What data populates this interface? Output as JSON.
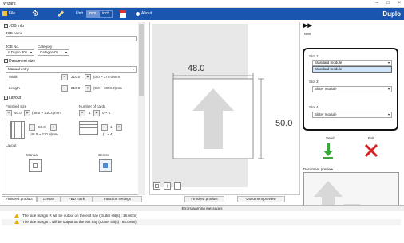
{
  "window": {
    "title": "Wizard",
    "minimize": "–",
    "maximize": "□",
    "close": "×"
  },
  "toolbar": {
    "file_label": "File",
    "unit_label": "Unit",
    "unit_mm": "mm",
    "unit_inch": "inch",
    "about_label": "About",
    "brand": "Duplo"
  },
  "left": {
    "job_info_title": "JOB info",
    "job_name_label": "JOB name",
    "job_name_value": "",
    "job_no_label": "JOB No.",
    "job_no_value": "n Duplo 801",
    "category_label": "Category",
    "category_value": "Category01",
    "doc_size_title": "Document size",
    "doc_size_mode": "Manual entry",
    "width_label": "Width",
    "width_value": "210.0",
    "width_range": "(0.0 ~ 370.0)mm",
    "length_label": "Length",
    "length_value": "210.0",
    "length_range": "(0.0 ~ 1000.0)mm",
    "layout_title": "Layout",
    "finished_size_label": "Finished size",
    "finished_size_value": "40.0",
    "finished_size_range": "(48.0 ~ 210.0)mm",
    "num_cards_label": "Number of cards",
    "num_cards_value": "1",
    "num_cards_range": "0 ~ 6",
    "inner_value": "50.0",
    "inner_range": "(48.0 ~ 210.0)mm",
    "inner_cards_value": "1",
    "inner_cards_range": "(1 ~ 4)",
    "layout_mode_label": "Layout",
    "manual_label": "Manual",
    "center_label": "Center"
  },
  "tabs": [
    "Finished product",
    "Crease",
    "FBD mark",
    "Function settings"
  ],
  "canvas": {
    "width_dim": "48.0",
    "height_dim": "50.0",
    "bottom_tabs": [
      "Finished product",
      "Document preview"
    ]
  },
  "right": {
    "next_label": "Next",
    "slot1_label": "Slot 1",
    "slot1_value": "Standard module",
    "slot1_option": "Standard module",
    "slot3_label": "Slot 3",
    "slot3_value": "Slitter module",
    "slot4_label": "Slot 4",
    "slot4_value": "Slitter module",
    "send_label": "Send",
    "exit_label": "Exit",
    "doc_preview_label": "Document preview"
  },
  "errors": {
    "header": "Errors/warning messages",
    "rows": [
      "The side margin R will be output on the exit tray (Gutter slit(s) :  39.0mm)",
      "The side margin L will be output on the exit tray (Cutter slit(s) :  55.0mm)"
    ]
  },
  "colors": {
    "toolbar": "#1a56b0",
    "send_arrow": "#3aa53a",
    "exit_x": "#d22222",
    "warning": "#e8b000"
  }
}
